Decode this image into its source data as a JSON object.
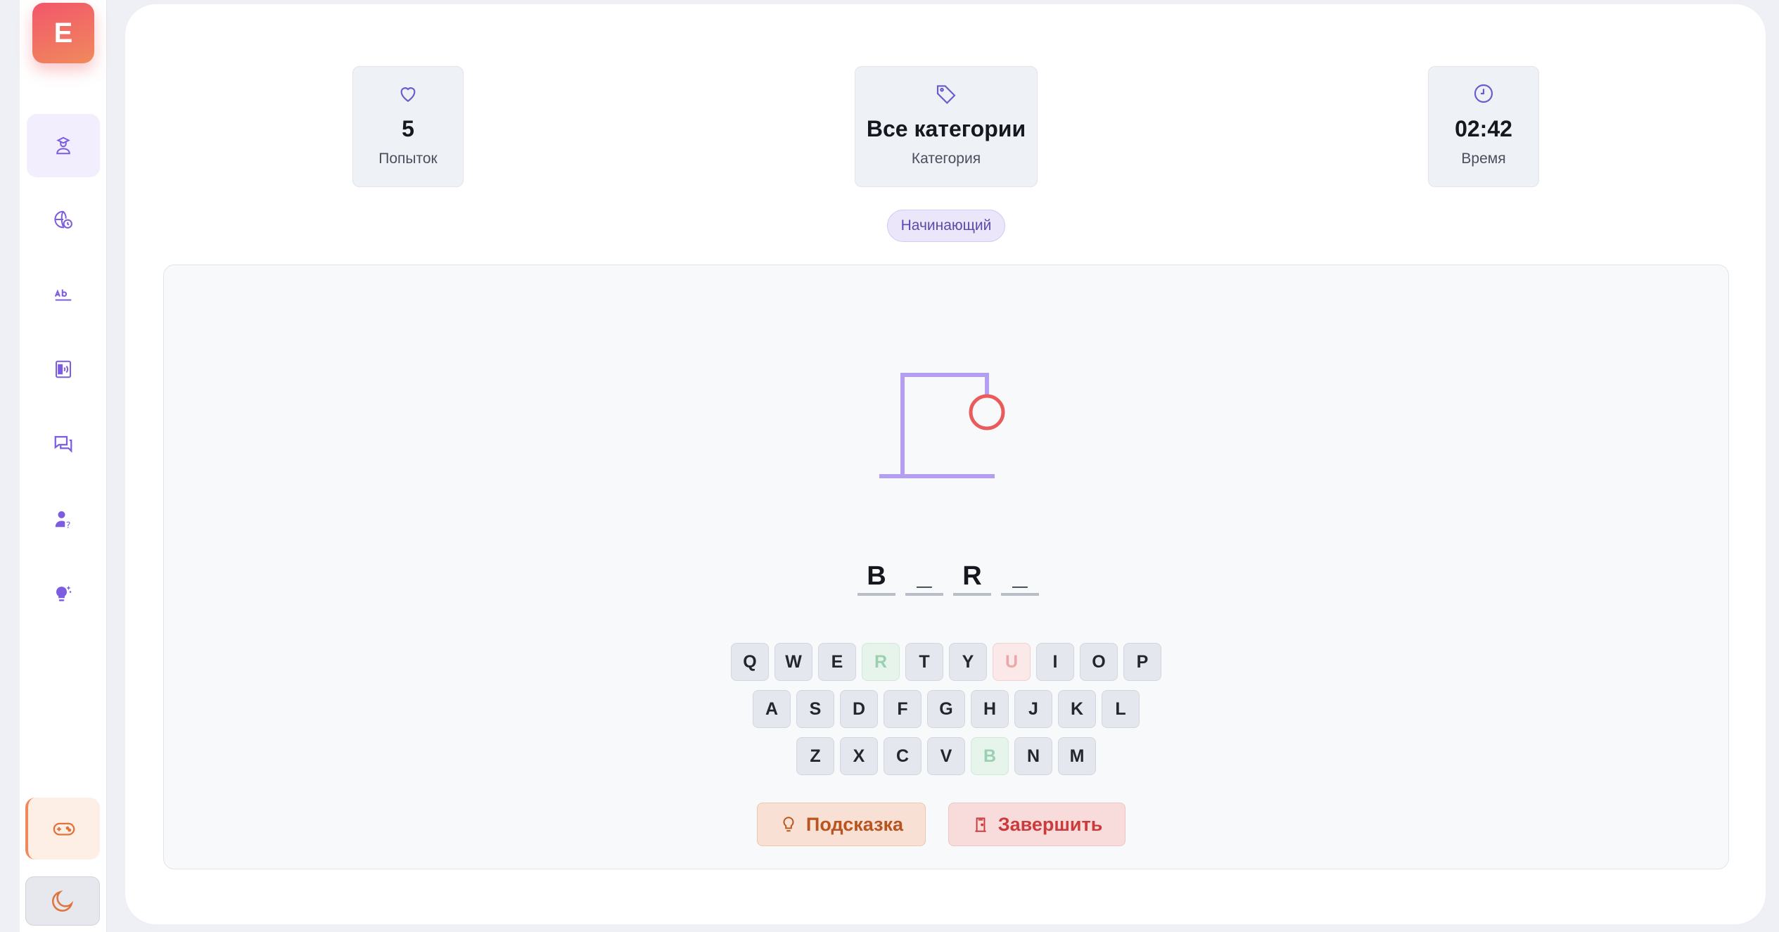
{
  "sidebar": {
    "logo_letter": "E",
    "items": [
      {
        "name": "learn",
        "icon": "graduation-user-icon"
      },
      {
        "name": "world",
        "icon": "globe-clock-icon"
      },
      {
        "name": "vocabulary",
        "icon": "ab-text-icon"
      },
      {
        "name": "listening",
        "icon": "audio-card-icon"
      },
      {
        "name": "chat",
        "icon": "chat-bubbles-icon"
      },
      {
        "name": "quiz",
        "icon": "user-question-icon"
      },
      {
        "name": "ideas",
        "icon": "lightbulb-sparkle-icon"
      }
    ],
    "game_icon": "gamepad-icon",
    "theme_icon": "moon-icon"
  },
  "stats": {
    "attempts": {
      "value": "5",
      "label": "Попыток",
      "icon": "heart-icon"
    },
    "category": {
      "value": "Все категории",
      "label": "Категория",
      "icon": "tag-icon"
    },
    "time": {
      "value": "02:42",
      "label": "Время",
      "icon": "clock-icon"
    }
  },
  "level_badge": "Начинающий",
  "word_slots": [
    "B",
    "_",
    "R",
    "_"
  ],
  "keyboard": {
    "rows": [
      [
        "Q",
        "W",
        "E",
        "R",
        "T",
        "Y",
        "U",
        "I",
        "O",
        "P"
      ],
      [
        "A",
        "S",
        "D",
        "F",
        "G",
        "H",
        "J",
        "K",
        "L"
      ],
      [
        "Z",
        "X",
        "C",
        "V",
        "B",
        "N",
        "M"
      ]
    ],
    "correct": [
      "R",
      "B"
    ],
    "wrong": [
      "U"
    ]
  },
  "actions": {
    "hint_label": "Подсказка",
    "finish_label": "Завершить"
  },
  "colors": {
    "accent": "#7c5ce0",
    "gallows": "#b39ef0",
    "head": "#ea5b5b",
    "hint": "#b9541f",
    "finish": "#cc3b3b"
  }
}
